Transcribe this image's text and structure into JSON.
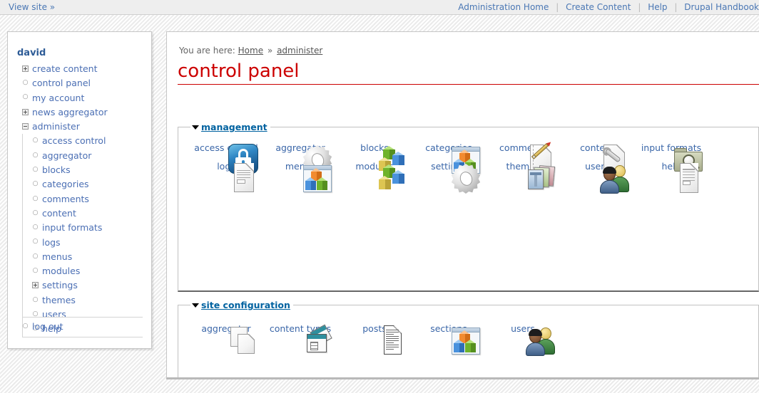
{
  "topbar": {
    "view_site": "View site",
    "view_site_chevron": "»",
    "links": [
      {
        "label": "Administration Home",
        "name": "administration-home-link"
      },
      {
        "label": "Create Content",
        "name": "create-content-link"
      },
      {
        "label": "Help",
        "name": "help-link"
      },
      {
        "label": "Drupal Handbook",
        "name": "drupal-handbook-link"
      }
    ],
    "separator": "|"
  },
  "sidebar": {
    "username": "david",
    "items": [
      {
        "label": "create content",
        "toggle": "plus",
        "depth": 0
      },
      {
        "label": "control panel",
        "toggle": "bullet",
        "depth": 0
      },
      {
        "label": "my account",
        "toggle": "bullet",
        "depth": 0
      },
      {
        "label": "news aggregator",
        "toggle": "plus",
        "depth": 0
      },
      {
        "label": "administer",
        "toggle": "minus",
        "depth": 0
      },
      {
        "label": "access control",
        "toggle": "bullet",
        "depth": 1
      },
      {
        "label": "aggregator",
        "toggle": "bullet",
        "depth": 1
      },
      {
        "label": "blocks",
        "toggle": "bullet",
        "depth": 1
      },
      {
        "label": "categories",
        "toggle": "bullet",
        "depth": 1
      },
      {
        "label": "comments",
        "toggle": "bullet",
        "depth": 1
      },
      {
        "label": "content",
        "toggle": "bullet",
        "depth": 1
      },
      {
        "label": "input formats",
        "toggle": "bullet",
        "depth": 1
      },
      {
        "label": "logs",
        "toggle": "bullet",
        "depth": 1
      },
      {
        "label": "menus",
        "toggle": "bullet",
        "depth": 1
      },
      {
        "label": "modules",
        "toggle": "bullet",
        "depth": 1
      },
      {
        "label": "settings",
        "toggle": "plus",
        "depth": 1
      },
      {
        "label": "themes",
        "toggle": "bullet",
        "depth": 1
      },
      {
        "label": "users",
        "toggle": "bullet",
        "depth": 1
      },
      {
        "label": "help",
        "toggle": "bullet",
        "depth": 1
      }
    ],
    "logout": {
      "label": "log out",
      "toggle": "bullet"
    }
  },
  "breadcrumb": {
    "prefix": "You are here:",
    "separator": "»",
    "items": [
      "Home",
      "administer"
    ]
  },
  "page": {
    "title": "control panel",
    "title_color": "#cc0000"
  },
  "sections": [
    {
      "id": "management",
      "legend": "management",
      "icons": [
        {
          "label": "access control",
          "icon": "lock-icon"
        },
        {
          "label": "aggregator",
          "icon": "gear-icon"
        },
        {
          "label": "blocks",
          "icon": "cubes-icon"
        },
        {
          "label": "categories",
          "icon": "window-cubes-icon"
        },
        {
          "label": "comments",
          "icon": "page-pencil-icon"
        },
        {
          "label": "content",
          "icon": "page-wrench-icon"
        },
        {
          "label": "input formats",
          "icon": "folder-search-icon"
        },
        {
          "label": "logs",
          "icon": "lined-document-icon"
        },
        {
          "label": "menus",
          "icon": "window-cubes-icon"
        },
        {
          "label": "modules",
          "icon": "cubes-icon"
        },
        {
          "label": "settings",
          "icon": "gear-icon"
        },
        {
          "label": "themes",
          "icon": "stacked-cards-icon"
        },
        {
          "label": "users",
          "icon": "people-icon"
        },
        {
          "label": "help",
          "icon": "help-document-icon"
        }
      ]
    },
    {
      "id": "site-configuration",
      "legend": "site configuration",
      "icons": [
        {
          "label": "aggregator",
          "icon": "two-pages-icon"
        },
        {
          "label": "content types",
          "icon": "content-types-icon"
        },
        {
          "label": "posts",
          "icon": "text-document-icon"
        },
        {
          "label": "sections",
          "icon": "window-cubes-icon"
        },
        {
          "label": "users",
          "icon": "people-icon"
        }
      ]
    }
  ],
  "colors": {
    "link": "#4a77b4",
    "title": "#cc0000",
    "legend": "#0062a0",
    "icon_label": "#3a66a8",
    "sidebar_link": "#4b6fb4"
  }
}
